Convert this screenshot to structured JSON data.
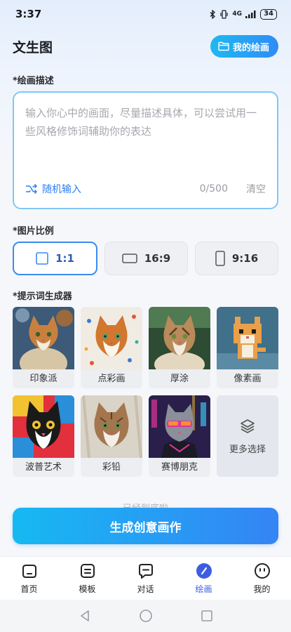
{
  "status_bar": {
    "time": "3:37",
    "network": "4G",
    "battery": "34"
  },
  "header": {
    "title": "文生图",
    "my_drawing_label": "我的绘画"
  },
  "description": {
    "section_label": "*绘画描述",
    "value": "",
    "placeholder": "输入你心中的画面，尽量描述具体，可以尝试用一些风格修饰词辅助你的表达",
    "random_label": "随机输入",
    "counter": "0/500",
    "clear_label": "清空"
  },
  "ratio": {
    "section_label": "*图片比例",
    "selected": "1:1",
    "options": [
      {
        "label": "1:1",
        "icon": "square-ratio-icon"
      },
      {
        "label": "16:9",
        "icon": "landscape-ratio-icon"
      },
      {
        "label": "9:16",
        "icon": "portrait-ratio-icon"
      }
    ]
  },
  "styles": {
    "section_label": "*提示词生成器",
    "items": [
      {
        "label": "印象派",
        "colors": [
          "#3d5a78",
          "#c9803e"
        ]
      },
      {
        "label": "点彩画",
        "colors": [
          "#f1ece3",
          "#d1772e"
        ]
      },
      {
        "label": "厚涂",
        "colors": [
          "#2e4b33",
          "#b98a5a"
        ]
      },
      {
        "label": "像素画",
        "colors": [
          "#41708a",
          "#e8a04a"
        ]
      },
      {
        "label": "波普艺术",
        "colors": [
          "#e2303d",
          "#f2c230"
        ]
      },
      {
        "label": "彩铅",
        "colors": [
          "#d9d3c8",
          "#a3764e"
        ]
      },
      {
        "label": "赛博朋克",
        "colors": [
          "#2a1f4a",
          "#e0349a"
        ]
      }
    ],
    "more_label": "更多选择"
  },
  "end_text": "已经到底啦",
  "generate_label": "生成创意画作",
  "tabs": [
    {
      "label": "首页",
      "icon": "home-icon"
    },
    {
      "label": "模板",
      "icon": "template-icon"
    },
    {
      "label": "对话",
      "icon": "chat-icon"
    },
    {
      "label": "绘画",
      "icon": "paint-icon"
    },
    {
      "label": "我的",
      "icon": "profile-icon"
    }
  ],
  "active_tab": "绘画",
  "colors": {
    "accent": "#2f7ef0",
    "active_tab": "#3d5ce0"
  }
}
